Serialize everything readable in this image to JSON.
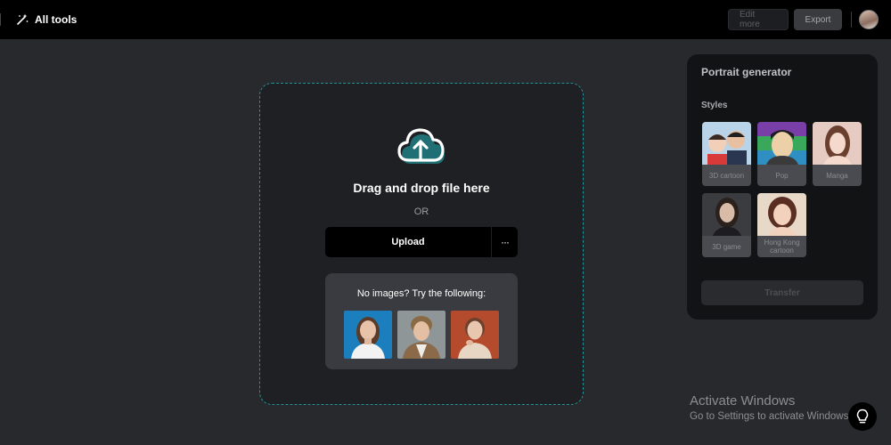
{
  "topbar": {
    "title": "All tools",
    "edit_more_label": "Edit more",
    "export_label": "Export"
  },
  "dropzone": {
    "title": "Drag and drop file here",
    "or_text": "OR",
    "upload_label": "Upload",
    "more_label": "···",
    "samples_title": "No images? Try the following:"
  },
  "panel": {
    "title": "Portrait generator",
    "styles_label": "Styles",
    "styles": [
      {
        "label": "3D cartoon"
      },
      {
        "label": "Pop"
      },
      {
        "label": "Manga"
      },
      {
        "label": "3D game"
      },
      {
        "label": "Hong Kong cartoon"
      }
    ],
    "transfer_label": "Transfer"
  },
  "watermark": {
    "title": "Activate Windows",
    "subtitle": "Go to Settings to activate Windows."
  },
  "colors": {
    "accent": "#21949a",
    "background": "#28292d",
    "topbar": "#000000"
  }
}
